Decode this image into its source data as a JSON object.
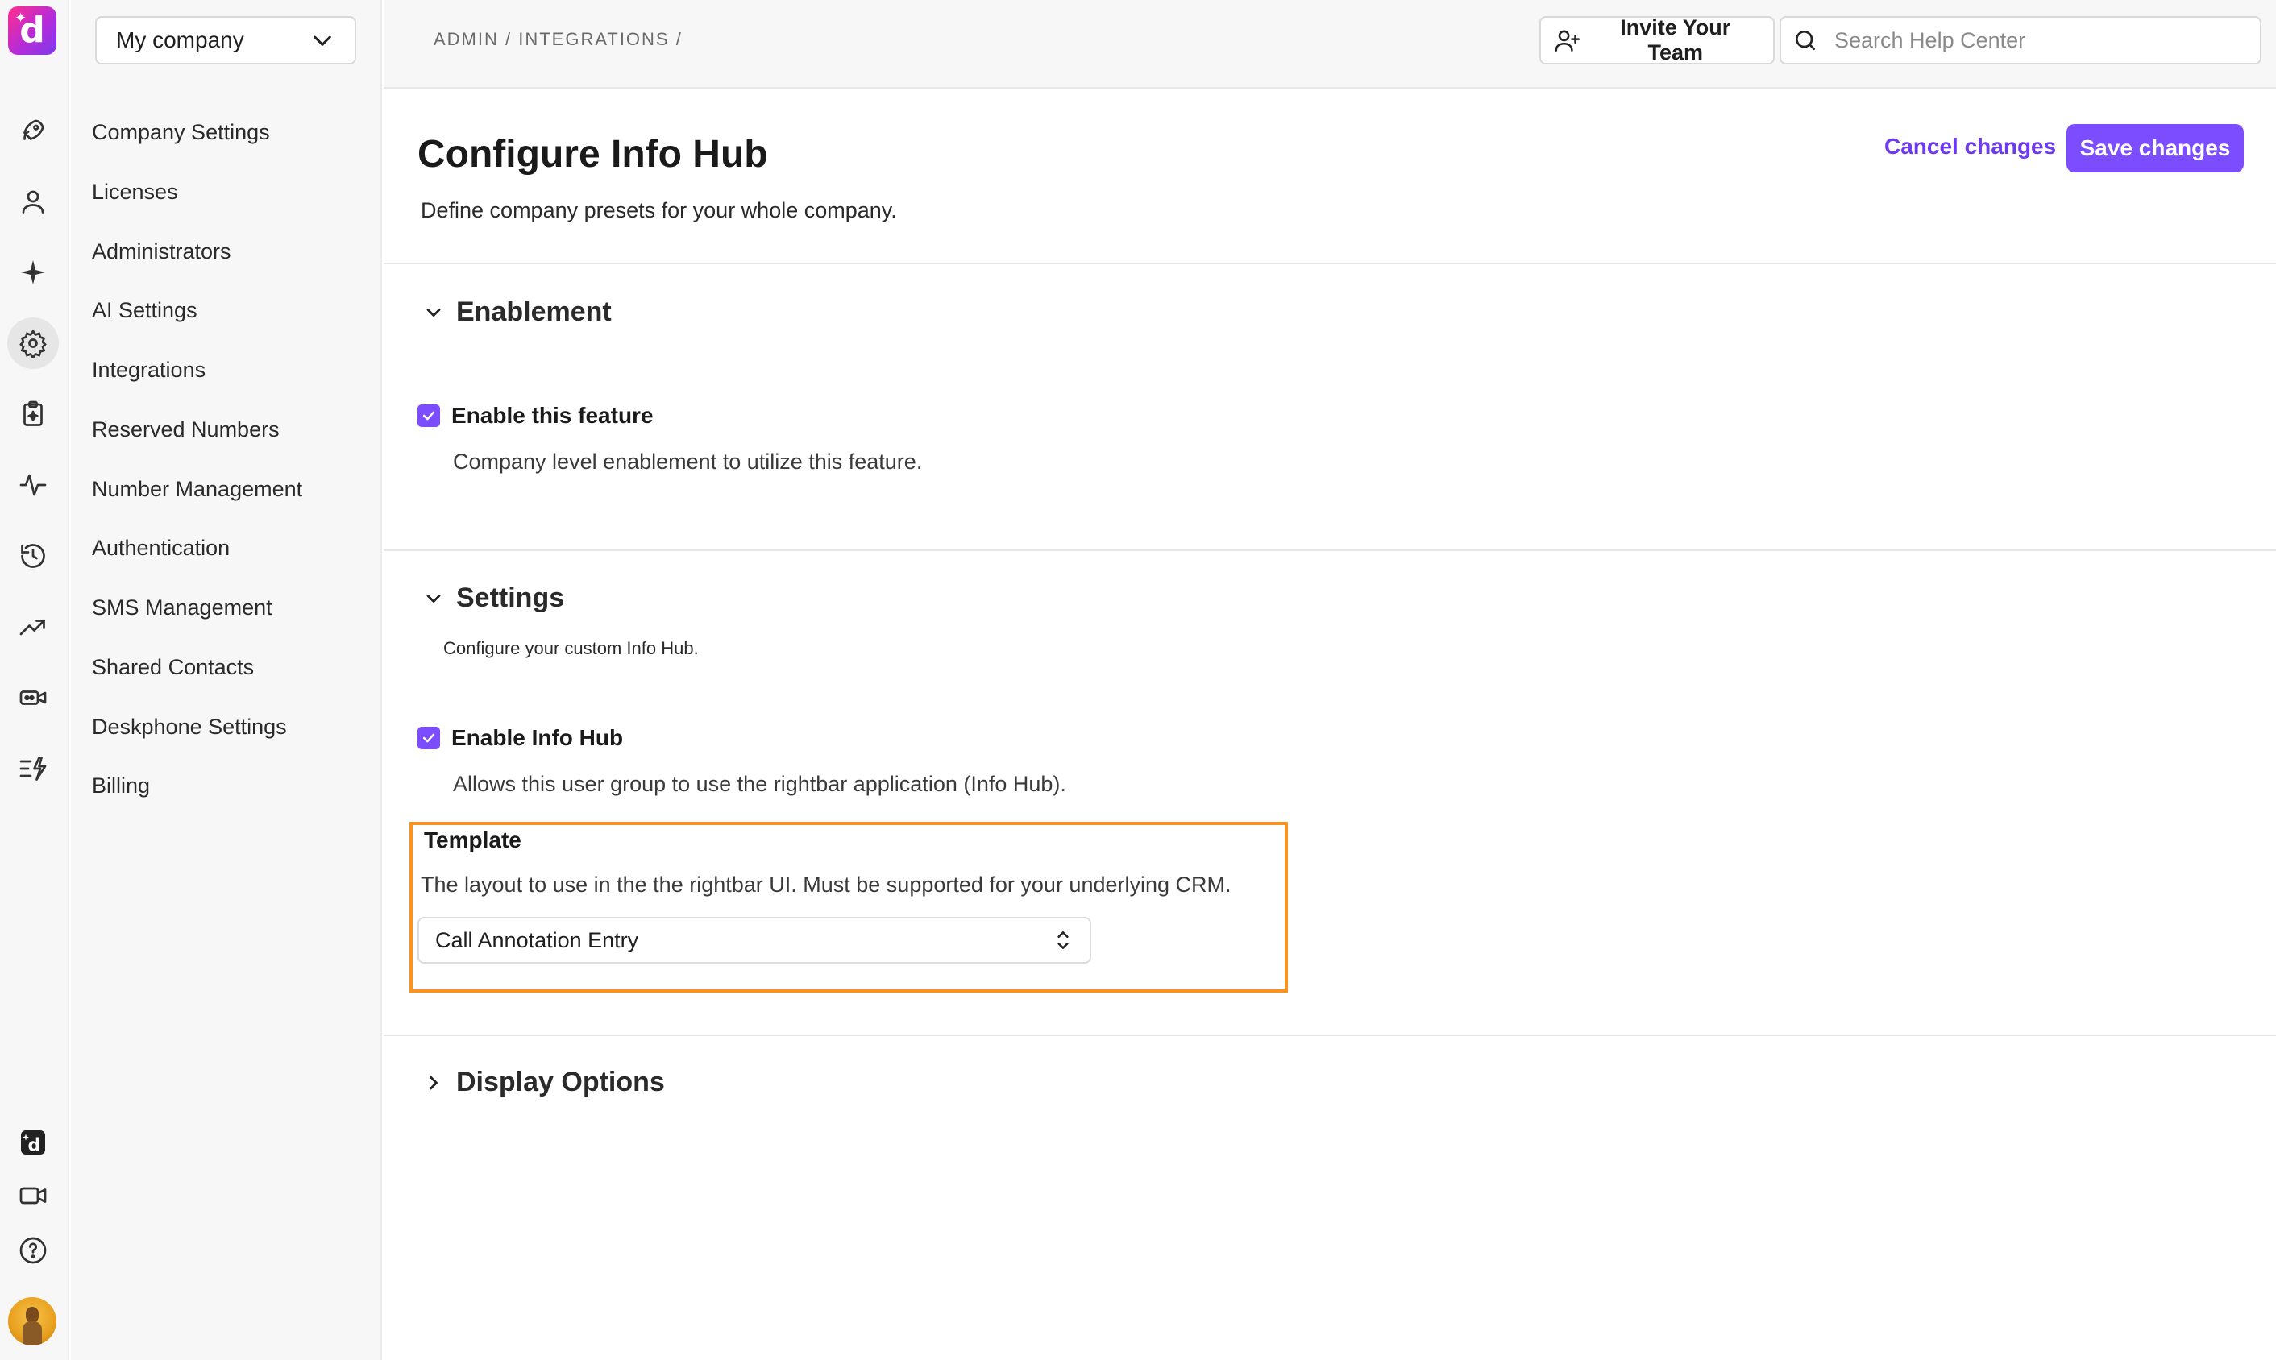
{
  "company_selector": {
    "value": "My company"
  },
  "nav": {
    "items": [
      {
        "label": "Company Settings"
      },
      {
        "label": "Licenses"
      },
      {
        "label": "Administrators"
      },
      {
        "label": "AI Settings"
      },
      {
        "label": "Integrations"
      },
      {
        "label": "Reserved Numbers"
      },
      {
        "label": "Number Management"
      },
      {
        "label": "Authentication"
      },
      {
        "label": "SMS Management"
      },
      {
        "label": "Shared Contacts"
      },
      {
        "label": "Deskphone Settings"
      },
      {
        "label": "Billing"
      }
    ]
  },
  "rail": {
    "icons": [
      "rocket-icon",
      "person-icon",
      "sparkle-icon",
      "gear-icon",
      "clipboard-sparkle-icon",
      "pulse-icon",
      "history-icon",
      "trending-icon",
      "video-bot-icon",
      "lightning-list-icon",
      "app-logo-icon",
      "video-icon",
      "help-icon"
    ],
    "active": "gear-icon"
  },
  "header": {
    "breadcrumb": "ADMIN / INTEGRATIONS /",
    "invite_label": "Invite Your Team",
    "search_placeholder": "Search Help Center"
  },
  "page": {
    "title": "Configure Info Hub",
    "subtitle": "Define company presets for your whole company.",
    "cancel_label": "Cancel changes",
    "save_label": "Save changes"
  },
  "sections": {
    "enablement": {
      "title": "Enablement",
      "checkbox_label": "Enable this feature",
      "checkbox_checked": true,
      "checkbox_desc": "Company level enablement to utilize this feature."
    },
    "settings": {
      "title": "Settings",
      "desc": "Configure your custom Info Hub.",
      "checkbox_label": "Enable Info Hub",
      "checkbox_checked": true,
      "checkbox_desc": "Allows this user group to use the rightbar application (Info Hub).",
      "template_label": "Template",
      "template_desc": "The layout to use in the the rightbar UI. Must be supported for your underlying CRM.",
      "template_value": "Call Annotation Entry"
    },
    "display_options": {
      "title": "Display Options"
    }
  },
  "colors": {
    "accent": "#7c4dff",
    "highlight_border": "#f7931e"
  }
}
